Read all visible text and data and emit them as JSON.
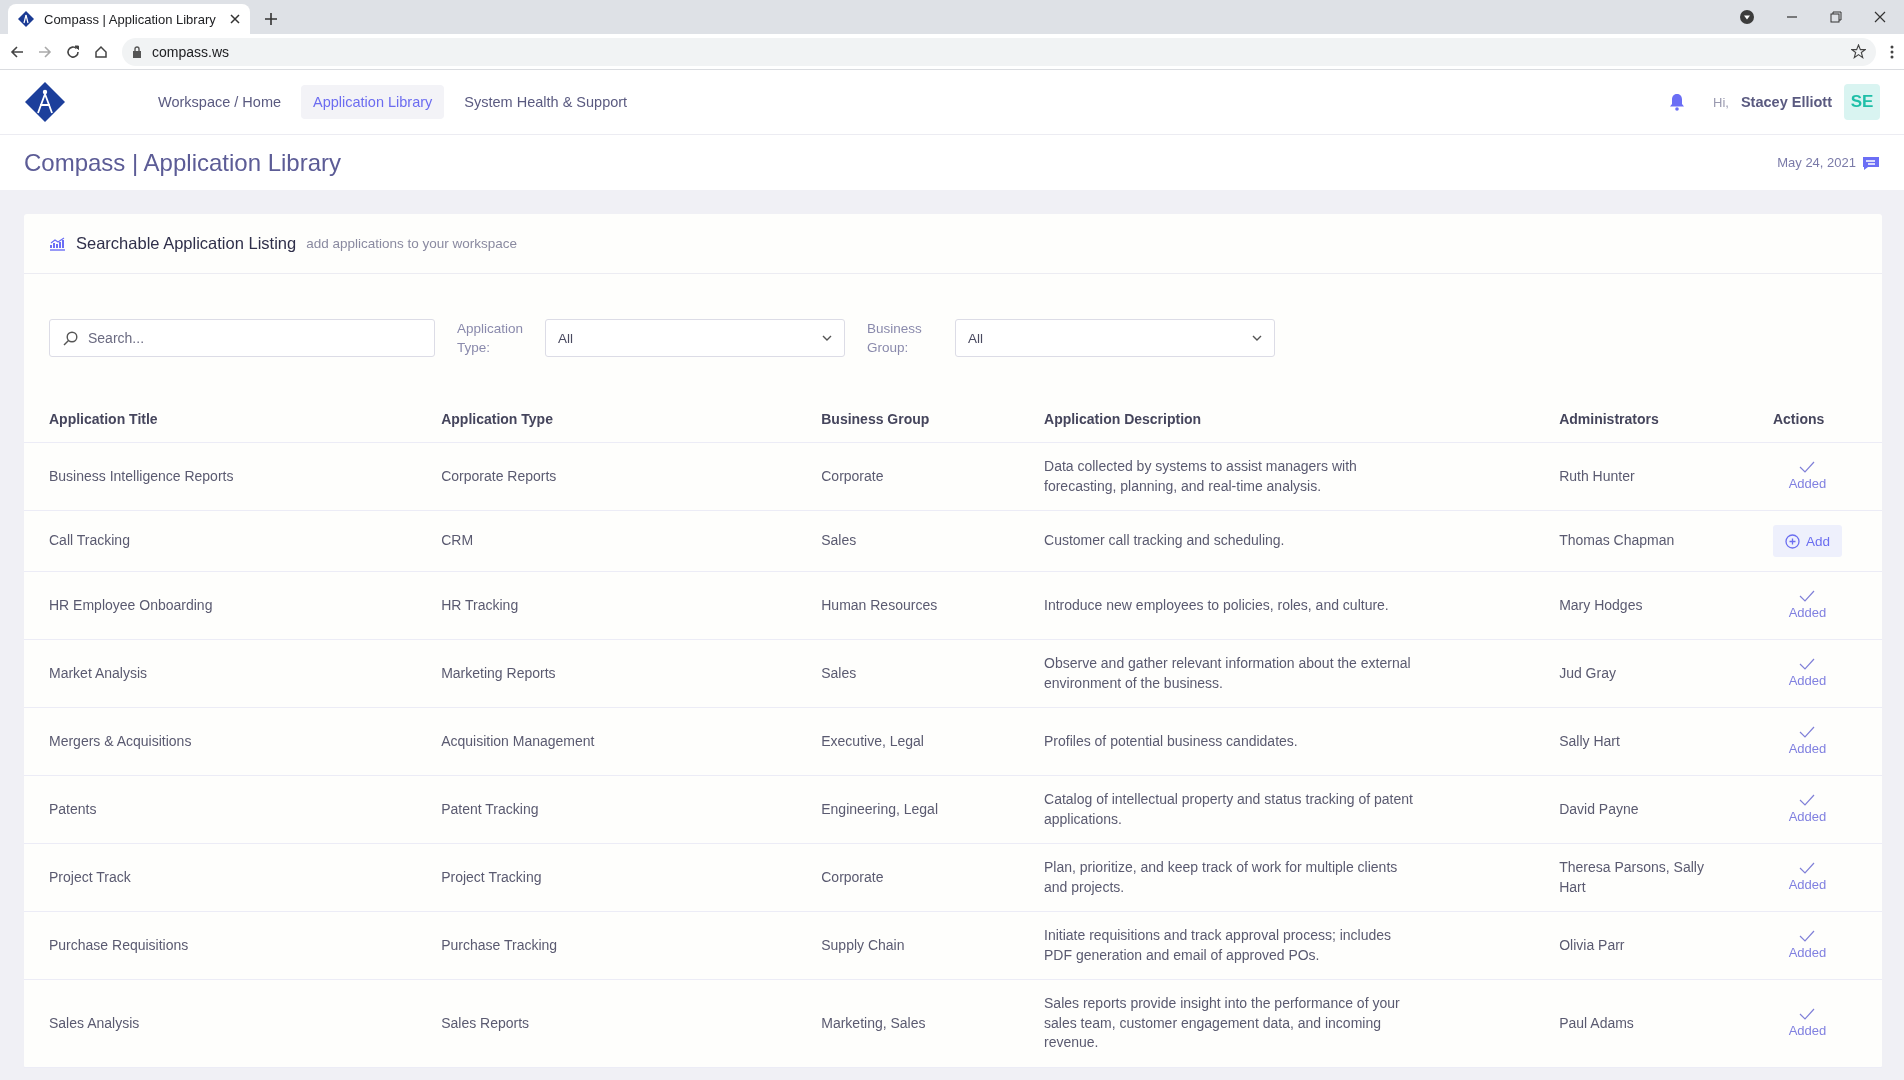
{
  "browser": {
    "tab_title": "Compass | Application Library",
    "address": "compass.ws"
  },
  "nav": [
    {
      "label": "Workspace / Home",
      "selected": false
    },
    {
      "label": "Application Library",
      "selected": true
    },
    {
      "label": "System Health & Support",
      "selected": false
    }
  ],
  "user": {
    "greeting": "Hi,",
    "name": "Stacey Elliott",
    "initials": "SE"
  },
  "page": {
    "title": "Compass | Application Library",
    "date": "May 24, 2021"
  },
  "listing": {
    "title": "Searchable Application Listing",
    "subtitle": "add applications to your workspace",
    "search": {
      "placeholder": "Search..."
    },
    "filters": [
      {
        "label": "Application Type:",
        "value": "All"
      },
      {
        "label": "Business Group:",
        "value": "All"
      }
    ],
    "columns": [
      "Application Title",
      "Application Type",
      "Business Group",
      "Application Description",
      "Administrators",
      "Actions"
    ],
    "rows": [
      {
        "title": "Business Intelligence Reports",
        "type": "Corporate Reports",
        "group": "Corporate",
        "description": "Data collected by systems to assist managers with forecasting, planning, and real-time analysis.",
        "admins": "Ruth Hunter",
        "added": true,
        "action": "Added"
      },
      {
        "title": "Call Tracking",
        "type": "CRM",
        "group": "Sales",
        "description": "Customer call tracking and scheduling.",
        "admins": "Thomas Chapman",
        "added": false,
        "action": "Add"
      },
      {
        "title": "HR Employee Onboarding",
        "type": "HR Tracking",
        "group": "Human Resources",
        "description": "Introduce new employees to policies, roles, and culture.",
        "admins": "Mary Hodges",
        "added": true,
        "action": "Added"
      },
      {
        "title": "Market Analysis",
        "type": "Marketing Reports",
        "group": "Sales",
        "description": "Observe and gather relevant information about the external environment of the business.",
        "admins": "Jud Gray",
        "added": true,
        "action": "Added"
      },
      {
        "title": "Mergers & Acquisitions",
        "type": "Acquisition Management",
        "group": "Executive, Legal",
        "description": "Profiles of potential business candidates.",
        "admins": "Sally Hart",
        "added": true,
        "action": "Added"
      },
      {
        "title": "Patents",
        "type": "Patent Tracking",
        "group": "Engineering, Legal",
        "description": "Catalog of intellectual property and status tracking of patent applications.",
        "admins": "David Payne",
        "added": true,
        "action": "Added"
      },
      {
        "title": "Project Track",
        "type": "Project Tracking",
        "group": "Corporate",
        "description": "Plan, prioritize, and keep track of work for multiple clients and projects.",
        "admins": "Theresa Parsons, Sally Hart",
        "added": true,
        "action": "Added"
      },
      {
        "title": "Purchase Requisitions",
        "type": "Purchase Tracking",
        "group": "Supply Chain",
        "description": "Initiate requisitions and track approval process; includes PDF generation and email of approved POs.",
        "admins": "Olivia Parr",
        "added": true,
        "action": "Added"
      },
      {
        "title": "Sales Analysis",
        "type": "Sales Reports",
        "group": "Marketing, Sales",
        "description": "Sales reports provide insight into the performance of your sales team, customer engagement data, and incoming revenue.",
        "admins": "Paul Adams",
        "added": true,
        "action": "Added"
      }
    ]
  }
}
